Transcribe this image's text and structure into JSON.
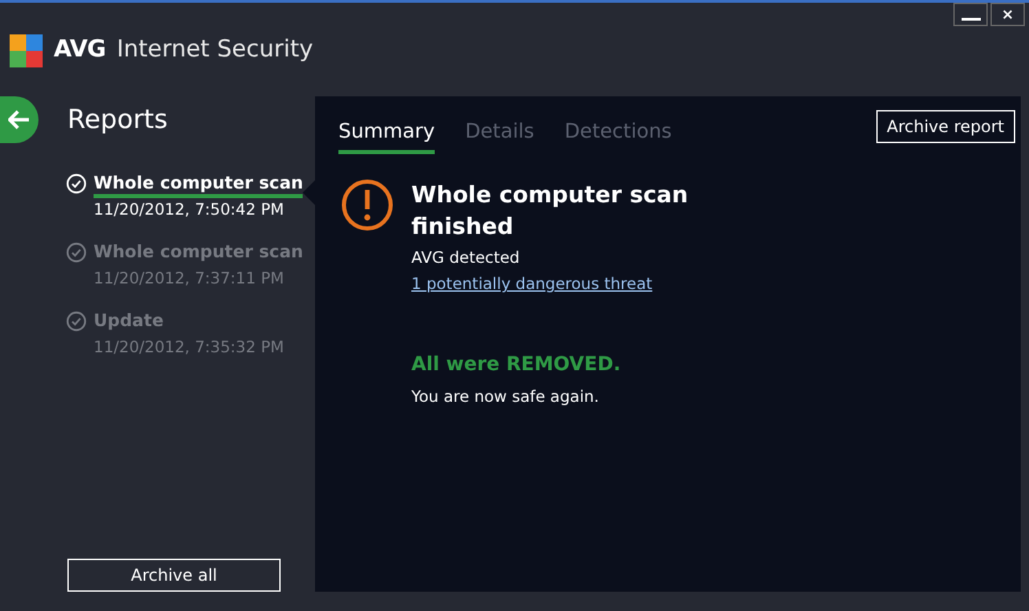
{
  "window": {
    "brand": "AVG",
    "title": "Internet Security",
    "close": "×"
  },
  "sidebar": {
    "title": "Reports",
    "items": [
      {
        "name": "Whole computer scan",
        "time": "11/20/2012, 7:50:42 PM",
        "selected": true
      },
      {
        "name": "Whole computer scan",
        "time": "11/20/2012, 7:37:11 PM",
        "selected": false
      },
      {
        "name": "Update",
        "time": "11/20/2012, 7:35:32 PM",
        "selected": false
      }
    ],
    "archive_all": "Archive all"
  },
  "tabs": [
    {
      "label": "Summary",
      "selected": true
    },
    {
      "label": "Details",
      "selected": false
    },
    {
      "label": "Detections",
      "selected": false
    }
  ],
  "archive_report": "Archive report",
  "summary": {
    "title": "Whole computer scan finished",
    "detected": "AVG detected",
    "threat_link": "1 potentially dangerous threat",
    "result": "All were REMOVED.",
    "message": "You are now safe again."
  }
}
